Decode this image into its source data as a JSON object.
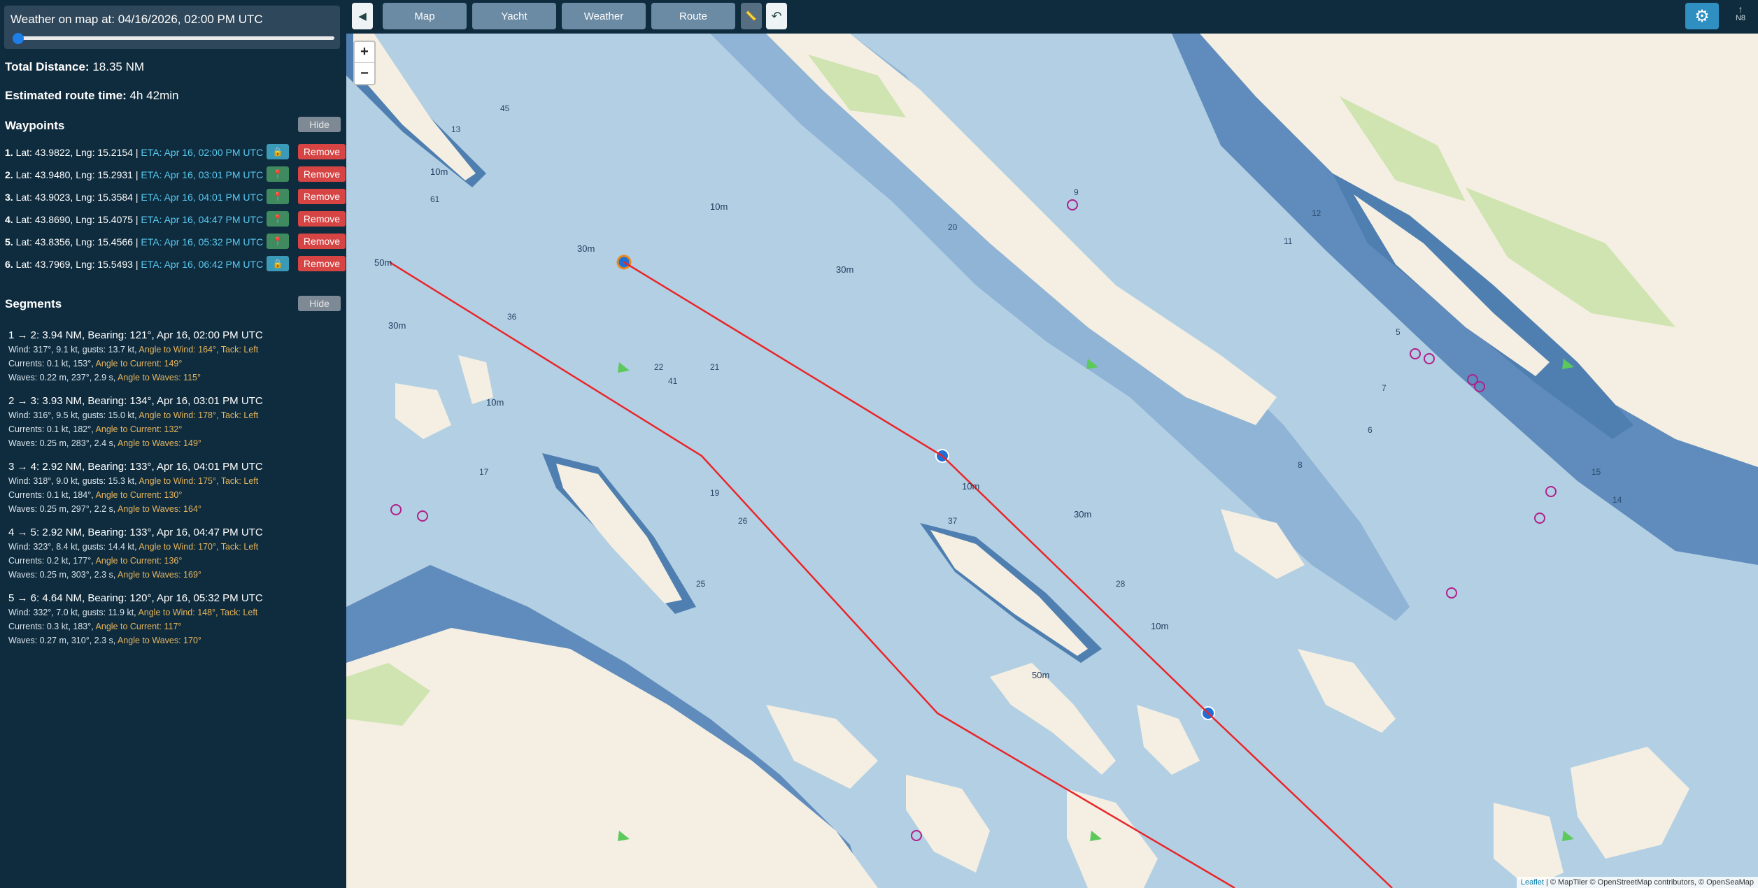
{
  "weather": {
    "label": "Weather on map at: 04/16/2026, 02:00 PM UTC",
    "slider_value": 0
  },
  "summary": {
    "distance_label": "Total Distance:",
    "distance_value": "18.35 NM",
    "time_label": "Estimated route time:",
    "time_value": "4h 42min"
  },
  "waypoints_section": {
    "title": "Waypoints",
    "hide_label": "Hide"
  },
  "waypoints": [
    {
      "num": "1.",
      "coords": "Lat: 43.9822, Lng: 15.2154 |",
      "eta": "ETA: Apr 16, 02:00 PM UTC",
      "icon": "lock-icon",
      "icon_glyph": "🔒",
      "remove": "Remove"
    },
    {
      "num": "2.",
      "coords": "Lat: 43.9480, Lng: 15.2931 |",
      "eta": "ETA: Apr 16, 03:01 PM UTC",
      "icon": "pin-icon",
      "icon_glyph": "📍",
      "remove": "Remove"
    },
    {
      "num": "3.",
      "coords": "Lat: 43.9023, Lng: 15.3584 |",
      "eta": "ETA: Apr 16, 04:01 PM UTC",
      "icon": "pin-icon",
      "icon_glyph": "📍",
      "remove": "Remove"
    },
    {
      "num": "4.",
      "coords": "Lat: 43.8690, Lng: 15.4075 |",
      "eta": "ETA: Apr 16, 04:47 PM UTC",
      "icon": "pin-icon",
      "icon_glyph": "📍",
      "remove": "Remove"
    },
    {
      "num": "5.",
      "coords": "Lat: 43.8356, Lng: 15.4566 |",
      "eta": "ETA: Apr 16, 05:32 PM UTC",
      "icon": "pin-icon",
      "icon_glyph": "📍",
      "remove": "Remove"
    },
    {
      "num": "6.",
      "coords": "Lat: 43.7969, Lng: 15.5493 |",
      "eta": "ETA: Apr 16, 06:42 PM UTC",
      "icon": "lock-icon",
      "icon_glyph": "🔒",
      "remove": "Remove"
    }
  ],
  "segments_section": {
    "title": "Segments",
    "hide_label": "Hide"
  },
  "segments": [
    {
      "head": "1 → 2: 3.94 NM, Bearing: 121°, Apr 16, 02:00 PM UTC",
      "wind": "Wind: 317°, 9.1 kt, gusts: 13.7 kt,",
      "wind_angle": "Angle to Wind: 164°,",
      "tack": "Tack: Left",
      "currents": "Currents: 0.1 kt, 153°,",
      "current_angle": "Angle to Current: 149°",
      "waves": "Waves: 0.22 m, 237°, 2.9 s,",
      "wave_angle": "Angle to Waves: 115°"
    },
    {
      "head": "2 → 3: 3.93 NM, Bearing: 134°, Apr 16, 03:01 PM UTC",
      "wind": "Wind: 316°, 9.5 kt, gusts: 15.0 kt,",
      "wind_angle": "Angle to Wind: 178°,",
      "tack": "Tack: Left",
      "currents": "Currents: 0.1 kt, 182°,",
      "current_angle": "Angle to Current: 132°",
      "waves": "Waves: 0.25 m, 283°, 2.4 s,",
      "wave_angle": "Angle to Waves: 149°"
    },
    {
      "head": "3 → 4: 2.92 NM, Bearing: 133°, Apr 16, 04:01 PM UTC",
      "wind": "Wind: 318°, 9.0 kt, gusts: 15.3 kt,",
      "wind_angle": "Angle to Wind: 175°,",
      "tack": "Tack: Left",
      "currents": "Currents: 0.1 kt, 184°,",
      "current_angle": "Angle to Current: 130°",
      "waves": "Waves: 0.25 m, 297°, 2.2 s,",
      "wave_angle": "Angle to Waves: 164°"
    },
    {
      "head": "4 → 5: 2.92 NM, Bearing: 133°, Apr 16, 04:47 PM UTC",
      "wind": "Wind: 323°, 8.4 kt, gusts: 14.4 kt,",
      "wind_angle": "Angle to Wind: 170°,",
      "tack": "Tack: Left",
      "currents": "Currents: 0.2 kt, 177°,",
      "current_angle": "Angle to Current: 136°",
      "waves": "Waves: 0.25 m, 303°, 2.3 s,",
      "wave_angle": "Angle to Waves: 169°"
    },
    {
      "head": "5 → 6: 4.64 NM, Bearing: 120°, Apr 16, 05:32 PM UTC",
      "wind": "Wind: 332°, 7.0 kt, gusts: 11.9 kt,",
      "wind_angle": "Angle to Wind: 148°,",
      "tack": "Tack: Left",
      "currents": "Currents: 0.3 kt, 183°,",
      "current_angle": "Angle to Current: 117°",
      "waves": "Waves: 0.27 m, 310°, 2.3 s,",
      "wave_angle": "Angle to Waves: 170°"
    }
  ],
  "toolbar": {
    "collapse_glyph": "◀",
    "map": "Map",
    "yacht": "Yacht",
    "weather": "Weather",
    "route": "Route",
    "ruler_glyph": "📏",
    "undo_glyph": "↶",
    "gear_glyph": "⚙",
    "compass_arrow": "↑",
    "compass_label": "N8"
  },
  "map": {
    "zoom_in": "+",
    "zoom_out": "−",
    "attribution_leaflet": "Leaflet",
    "attribution_rest": "| © MapTiler © OpenStreetMap contributors, © OpenSeaMap",
    "colors": {
      "water_shallow": "#4f7fb0",
      "water_mid": "#8fb4d6",
      "water_deep": "#b3cfe3",
      "land": "#f4efe2",
      "green": "#cfe4b0",
      "route": "#e8262a",
      "waypoint": "#1e6fd8",
      "waypoint_start": "#e88a1e"
    },
    "depths": [
      "10m",
      "30m",
      "50m",
      "10m",
      "30m",
      "10m",
      "30m",
      "10m",
      "30m",
      "50m",
      "10m",
      "13",
      "45",
      "61",
      "36",
      "41",
      "22",
      "21",
      "17",
      "19",
      "26",
      "37",
      "20",
      "25",
      "28",
      "12",
      "11",
      "9",
      "8",
      "7",
      "6",
      "5",
      "15",
      "14"
    ]
  }
}
